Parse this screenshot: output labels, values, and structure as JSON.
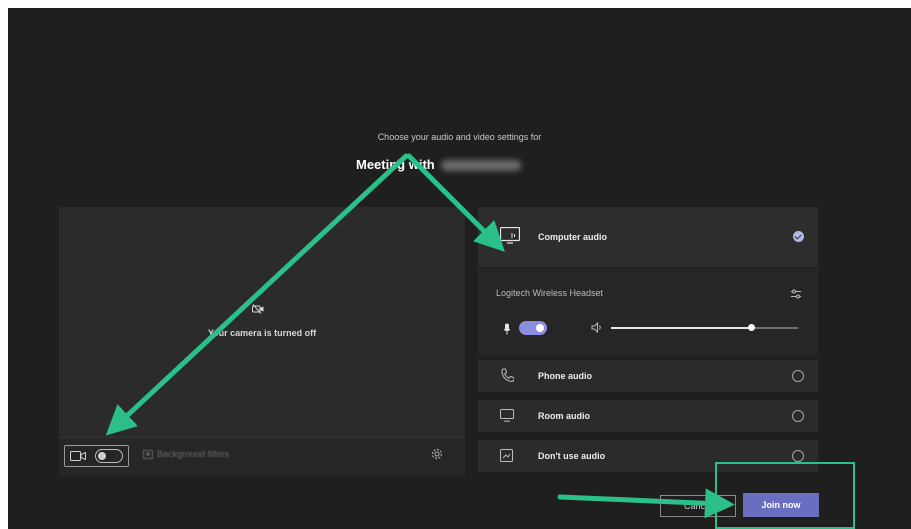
{
  "header": {
    "prompt": "Choose your audio and video settings for",
    "meeting_title": "Meeting with"
  },
  "video": {
    "camera_status": "Your camera is turned off",
    "background_filters_label": "Background filters",
    "camera_toggle_state": "off"
  },
  "audio": {
    "options": [
      {
        "label": "Computer audio",
        "icon": "monitor-audio-icon",
        "selected": true
      },
      {
        "label": "Phone audio",
        "icon": "phone-audio-icon",
        "selected": false
      },
      {
        "label": "Room audio",
        "icon": "room-audio-icon",
        "selected": false
      },
      {
        "label": "Don't use audio",
        "icon": "no-audio-icon",
        "selected": false
      }
    ],
    "device": {
      "name": "Logitech Wireless Headset",
      "mic_enabled": true,
      "volume_fraction": 0.75
    }
  },
  "actions": {
    "cancel_label": "Cancel",
    "join_label": "Join now"
  },
  "colors": {
    "background": "#1f1f1f",
    "accent": "#6a6ec0",
    "annotation": "#2bbf8a"
  }
}
